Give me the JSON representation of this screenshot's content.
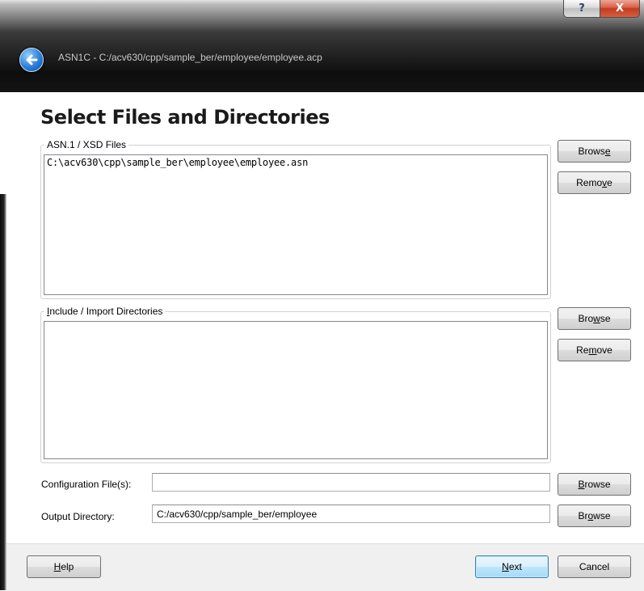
{
  "window": {
    "title": "ASN1C - C:/acv630/cpp/sample_ber/employee/employee.acp",
    "help_caption": "?",
    "close_caption": "X"
  },
  "page_title": "Select Files and Directories",
  "asn_files": {
    "legend": "ASN.1 / XSD Files",
    "items": [
      "C:\\acv630\\cpp\\sample_ber\\employee\\employee.asn"
    ],
    "browse": {
      "pre": "Brows",
      "key": "e",
      "post": ""
    },
    "remove": {
      "pre": "Remo",
      "key": "v",
      "post": "e"
    }
  },
  "include_dirs": {
    "legend": {
      "pre": "",
      "key": "I",
      "post": "nclude / Import Directories"
    },
    "items": [],
    "browse": {
      "pre": "Bro",
      "key": "w",
      "post": "se"
    },
    "remove": {
      "pre": "Re",
      "key": "m",
      "post": "ove"
    }
  },
  "config": {
    "label": "Configuration File(s):",
    "value": "",
    "browse": {
      "pre": "",
      "key": "B",
      "post": "rowse"
    }
  },
  "output": {
    "label": "Output Directory:",
    "value": "C:/acv630/cpp/sample_ber/employee",
    "browse": {
      "pre": "Br",
      "key": "o",
      "post": "wse"
    }
  },
  "footer": {
    "help": {
      "pre": "",
      "key": "H",
      "post": "elp"
    },
    "next": {
      "pre": "",
      "key": "N",
      "post": "ext"
    },
    "cancel": "Cancel"
  },
  "icons": {
    "back": "back-arrow-icon"
  }
}
